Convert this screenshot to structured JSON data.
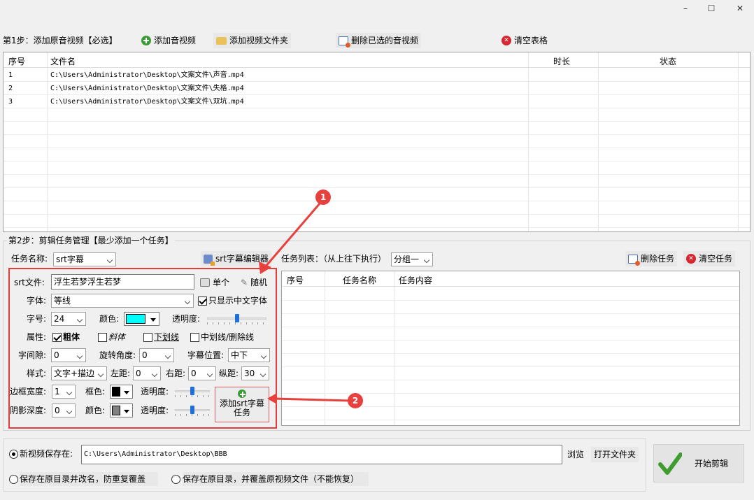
{
  "window": {
    "minimize": "–",
    "maximize": "☐",
    "close": "✕"
  },
  "step1": {
    "label": "第1步：添加原音视频【必选】",
    "add_audio_video": "添加音视频",
    "add_video_folder": "添加视频文件夹",
    "delete_selected": "删除已选的音视频",
    "clear_table": "清空表格"
  },
  "file_table": {
    "headers": [
      "序号",
      "文件名",
      "时长",
      "状态"
    ],
    "rows": [
      {
        "index": "1",
        "name": "C:\\Users\\Administrator\\Desktop\\文案文件\\声音.mp4"
      },
      {
        "index": "2",
        "name": "C:\\Users\\Administrator\\Desktop\\文案文件\\失格.mp4"
      },
      {
        "index": "3",
        "name": "C:\\Users\\Administrator\\Desktop\\文案文件\\双坑.mp4"
      }
    ]
  },
  "step2": {
    "label": "第2步：剪辑任务管理【最少添加一个任务】",
    "task_name_label": "任务名称:",
    "task_name_value": "srt字幕",
    "srt_editor": "srt字幕编辑器",
    "task_list_label": "任务列表：（从上往下执行）",
    "group_value": "分组一",
    "delete_task": "删除任务",
    "clear_tasks": "清空任务"
  },
  "task_table": {
    "headers": [
      "序号",
      "任务名称",
      "任务内容"
    ]
  },
  "form": {
    "srt_file_label": "srt文件:",
    "srt_file_value": "浮生若梦浮生若梦",
    "single": "单个",
    "random": "随机",
    "font_label": "字体:",
    "font_value": "等线",
    "chinese_only": "只显示中文字体",
    "size_label": "字号:",
    "size_value": "24",
    "color_label": "颜色:",
    "color_value": "#00ffff",
    "opacity_label": "透明度:",
    "attr_label": "属性:",
    "bold": "粗体",
    "italic": "斜体",
    "underline": "下划线",
    "strike": "中划线/删除线",
    "spacing_label": "字间隙:",
    "spacing_value": "0",
    "rotate_label": "旋转角度:",
    "rotate_value": "0",
    "position_label": "字幕位置:",
    "position_value": "中下",
    "style_label": "样式:",
    "style_value": "文字+描边",
    "left_label": "左距:",
    "left_value": "0",
    "right_label": "右距:",
    "right_value": "0",
    "vert_label": "纵距:",
    "vert_value": "30",
    "border_width_label": "边框宽度:",
    "border_width_value": "1",
    "border_color_label": "框色:",
    "border_color_value": "#000000",
    "border_opacity_label": "透明度:",
    "shadow_label": "阴影深度:",
    "shadow_value": "0",
    "shadow_color_label": "颜色:",
    "shadow_color_value": "#808080",
    "shadow_opacity_label": "透明度:",
    "add_task_line1": "添加srt字幕",
    "add_task_line2": "任务"
  },
  "callouts": {
    "one": "1",
    "two": "2"
  },
  "output": {
    "save_new_label": "新视频保存在:",
    "save_path": "C:\\Users\\Administrator\\Desktop\\BBB",
    "browse": "浏览",
    "open_folder": "打开文件夹",
    "rename_option": "保存在原目录并改名，防重复覆盖",
    "overwrite_option": "保存在原目录，并覆盖原视频文件（不能恢复）",
    "start": "开始剪辑"
  }
}
